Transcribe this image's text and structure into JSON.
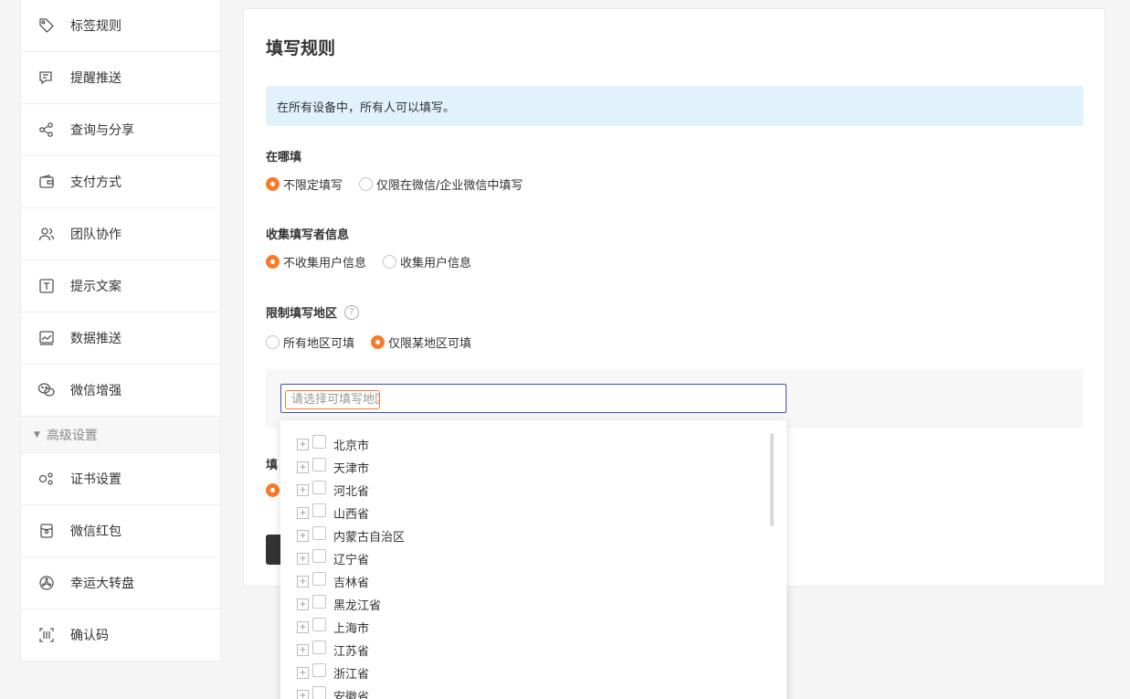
{
  "sidebar": {
    "items": [
      {
        "label": "标签规则",
        "icon": "tag-icon"
      },
      {
        "label": "提醒推送",
        "icon": "notification-icon"
      },
      {
        "label": "查询与分享",
        "icon": "share-icon"
      },
      {
        "label": "支付方式",
        "icon": "wallet-icon"
      },
      {
        "label": "团队协作",
        "icon": "team-icon"
      },
      {
        "label": "提示文案",
        "icon": "text-icon"
      },
      {
        "label": "数据推送",
        "icon": "chart-icon"
      },
      {
        "label": "微信增强",
        "icon": "wechat-icon"
      }
    ],
    "group_label": "高级设置",
    "advanced_items": [
      {
        "label": "证书设置",
        "icon": "certificate-icon"
      },
      {
        "label": "微信红包",
        "icon": "red-packet-icon"
      },
      {
        "label": "幸运大转盘",
        "icon": "lucky-wheel-icon"
      },
      {
        "label": "确认码",
        "icon": "barcode-icon"
      }
    ]
  },
  "main": {
    "title": "填写规则",
    "notice": "在所有设备中，所有人可以填写。",
    "sections": {
      "where": {
        "label": "在哪填",
        "options": [
          "不限定填写",
          "仅限在微信/企业微信中填写"
        ],
        "selected": 0
      },
      "collect": {
        "label": "收集填写者信息",
        "options": [
          "不收集用户信息",
          "收集用户信息"
        ],
        "selected": 0
      },
      "region": {
        "label": "限制填写地区",
        "options": [
          "所有地区可填",
          "仅限某地区可填"
        ],
        "selected": 1,
        "input_placeholder": "请选择可填写地区"
      },
      "partial_label": "填"
    }
  },
  "dropdown": {
    "provinces": [
      "北京市",
      "天津市",
      "河北省",
      "山西省",
      "内蒙古自治区",
      "辽宁省",
      "吉林省",
      "黑龙江省",
      "上海市",
      "江苏省",
      "浙江省",
      "安徽省"
    ]
  },
  "colors": {
    "accent": "#f97a2b",
    "notice_bg": "#e2f2fd",
    "input_border": "#3f51b5"
  }
}
